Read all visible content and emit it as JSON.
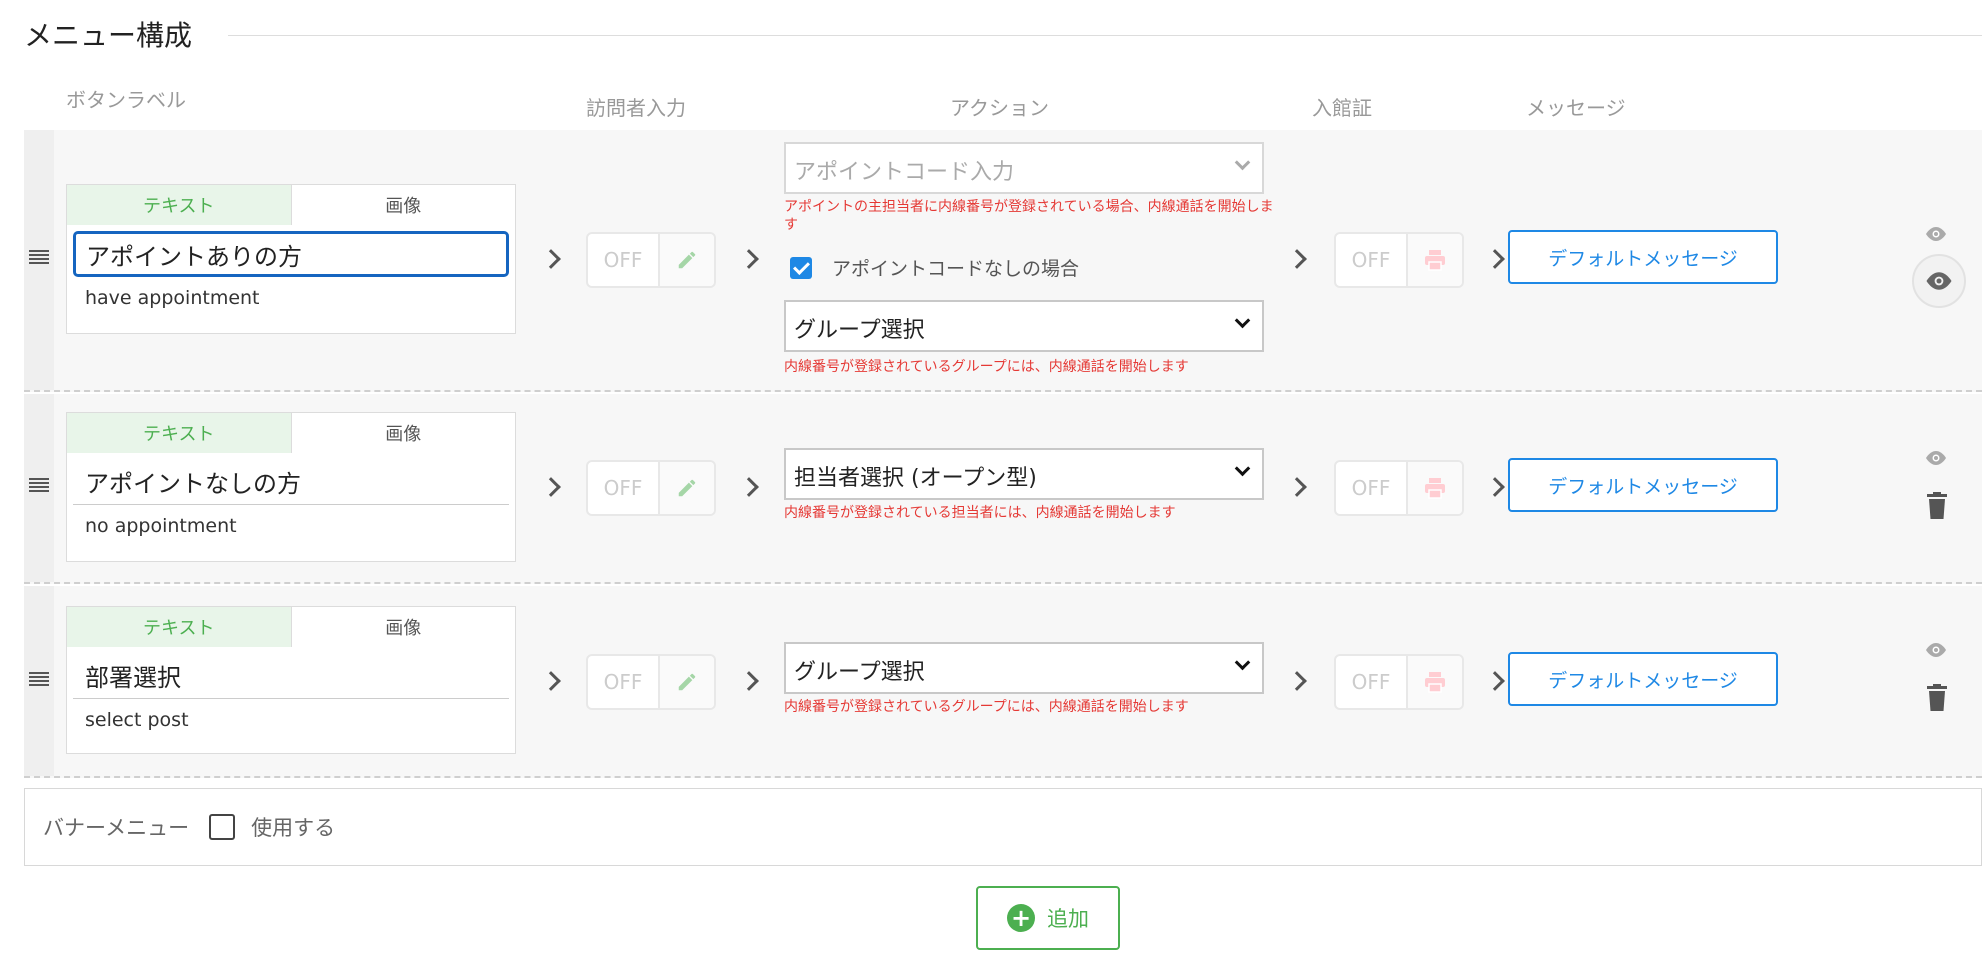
{
  "section": {
    "title": "メニュー構成"
  },
  "headers": {
    "button_label": "ボタンラベル",
    "visitor_input": "訪問者入力",
    "action": "アクション",
    "pass": "入館証",
    "message": "メッセージ"
  },
  "tabs": {
    "text": "テキスト",
    "image": "画像"
  },
  "toggle": {
    "off_label": "OFF"
  },
  "rows": [
    {
      "label": "アポイントありの方",
      "label_en": "have appointment",
      "action_select": "アポイントコード入力",
      "action_note": "アポイントの主担当者に内線番号が登録されている場合、内線通話を開始します",
      "checkbox_label": "アポイントコードなしの場合",
      "second_select": "グループ選択",
      "second_note": "内線番号が登録されているグループには、内線通話を開始します",
      "message_button": "デフォルトメッセージ"
    },
    {
      "label": "アポイントなしの方",
      "label_en": "no appointment",
      "action_select": "担当者選択 (オープン型)",
      "action_note": "内線番号が登録されている担当者には、内線通話を開始します",
      "message_button": "デフォルトメッセージ"
    },
    {
      "label": "部署選択",
      "label_en": "select post",
      "action_select": "グループ選択",
      "action_note": "内線番号が登録されているグループには、内線通話を開始します",
      "message_button": "デフォルトメッセージ"
    }
  ],
  "banner": {
    "label": "バナーメニュー",
    "checkbox_label": "使用する"
  },
  "add_button": {
    "label": "追加"
  },
  "colors": {
    "accent_green": "#4caf50",
    "accent_blue": "#1e88e5",
    "note_red": "#e53935"
  }
}
